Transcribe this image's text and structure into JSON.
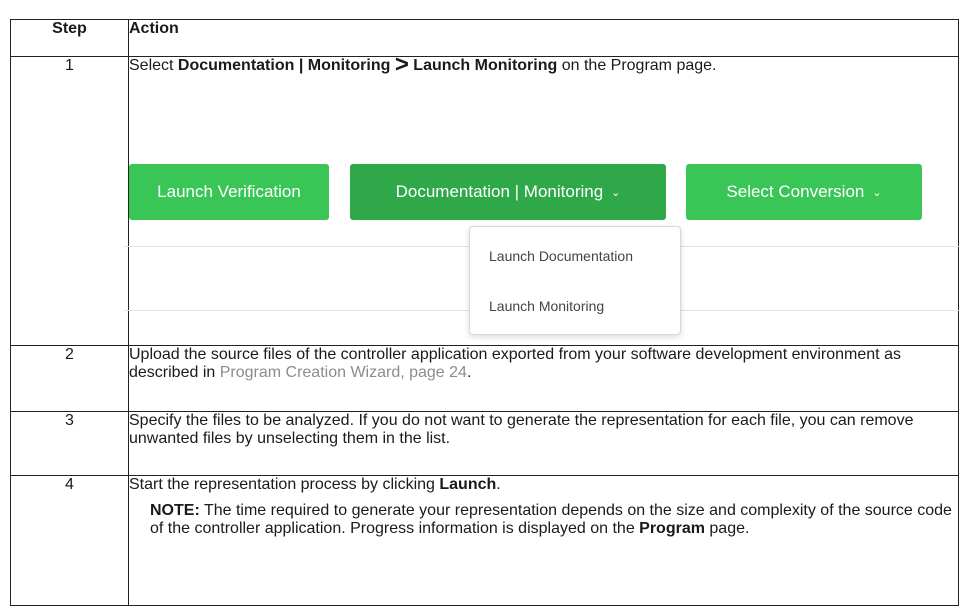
{
  "header": {
    "step": "Step",
    "action": "Action"
  },
  "rows": [
    {
      "num": "1",
      "text_a": "Select ",
      "bold_a": "Documentation | Monitoring",
      "arrow": ">",
      "bold_b": "Launch Monitoring",
      "text_b": " on the Program page.",
      "screenshot": {
        "buttons": {
          "verification": "Launch Verification",
          "documentation": "Documentation | Monitoring",
          "conversion": "Select Conversion"
        },
        "dropdown": [
          "Launch Documentation",
          "Launch Monitoring"
        ],
        "colors": {
          "button": "#3ac657",
          "button_active": "#2ea848"
        }
      }
    },
    {
      "num": "2",
      "text_a": "Upload the source files of the controller application exported from your software development environment as described in ",
      "link": "Program Creation Wizard, page 24",
      "text_b": "."
    },
    {
      "num": "3",
      "text": "Specify the files to be analyzed. If you do not want to generate the representation for each file, you can remove unwanted files by unselecting them in the list."
    },
    {
      "num": "4",
      "text_a": "Start the representation process by clicking ",
      "bold": "Launch",
      "text_b": ".",
      "note_label": "NOTE:",
      "note_text": " The time required to generate your representation depends on the size and complexity of the source code of the controller application. Progress information is displayed on the ",
      "note_bold": "Program",
      "note_end": " page."
    }
  ]
}
